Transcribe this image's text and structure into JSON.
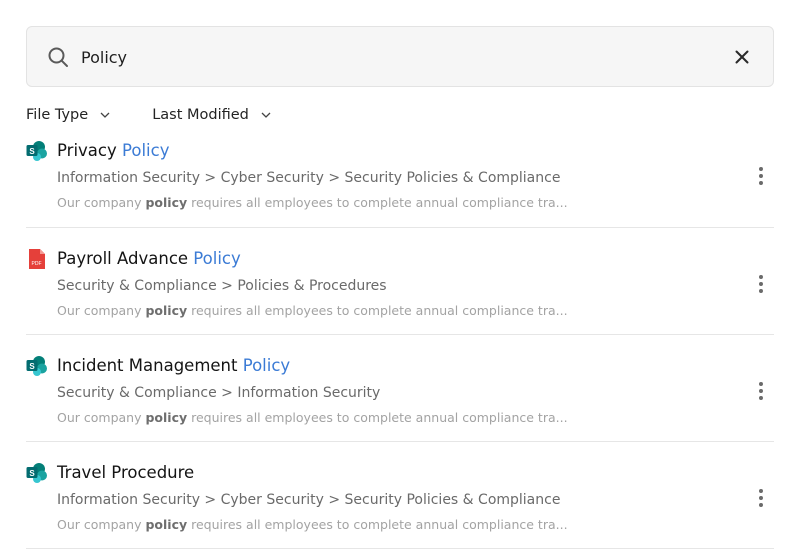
{
  "search": {
    "query": "Policy"
  },
  "filters": [
    {
      "label": "File Type"
    },
    {
      "label": "Last Modified"
    }
  ],
  "results": [
    {
      "icon": "sharepoint-icon",
      "title_prefix": "Privacy ",
      "title_highlight": "Policy",
      "path": "Information Security > Cyber Security > Security Policies & Compliance",
      "snippet_pre": "Our company ",
      "snippet_highlight": "policy",
      "snippet_post": " requires all employees to complete annual compliance tra..."
    },
    {
      "icon": "pdf-icon",
      "title_prefix": "Payroll Advance ",
      "title_highlight": "Policy",
      "path": "Security & Compliance > Policies & Procedures",
      "snippet_pre": "Our company ",
      "snippet_highlight": "policy",
      "snippet_post": " requires all employees to complete annual compliance tra..."
    },
    {
      "icon": "sharepoint-icon",
      "title_prefix": "Incident Management ",
      "title_highlight": "Policy",
      "path": "Security & Compliance > Information Security",
      "snippet_pre": "Our company ",
      "snippet_highlight": "policy",
      "snippet_post": " requires all employees to complete annual compliance tra..."
    },
    {
      "icon": "sharepoint-icon",
      "title_prefix": "Travel Procedure",
      "title_highlight": "",
      "path": "Information Security > Cyber Security > Security Policies & Compliance",
      "snippet_pre": "Our company ",
      "snippet_highlight": "policy",
      "snippet_post": " requires all employees to complete annual compliance tra..."
    }
  ],
  "colors": {
    "highlight": "#3b7bd5",
    "sharepoint": "#0f7b6f",
    "pdf": "#e5403a"
  }
}
